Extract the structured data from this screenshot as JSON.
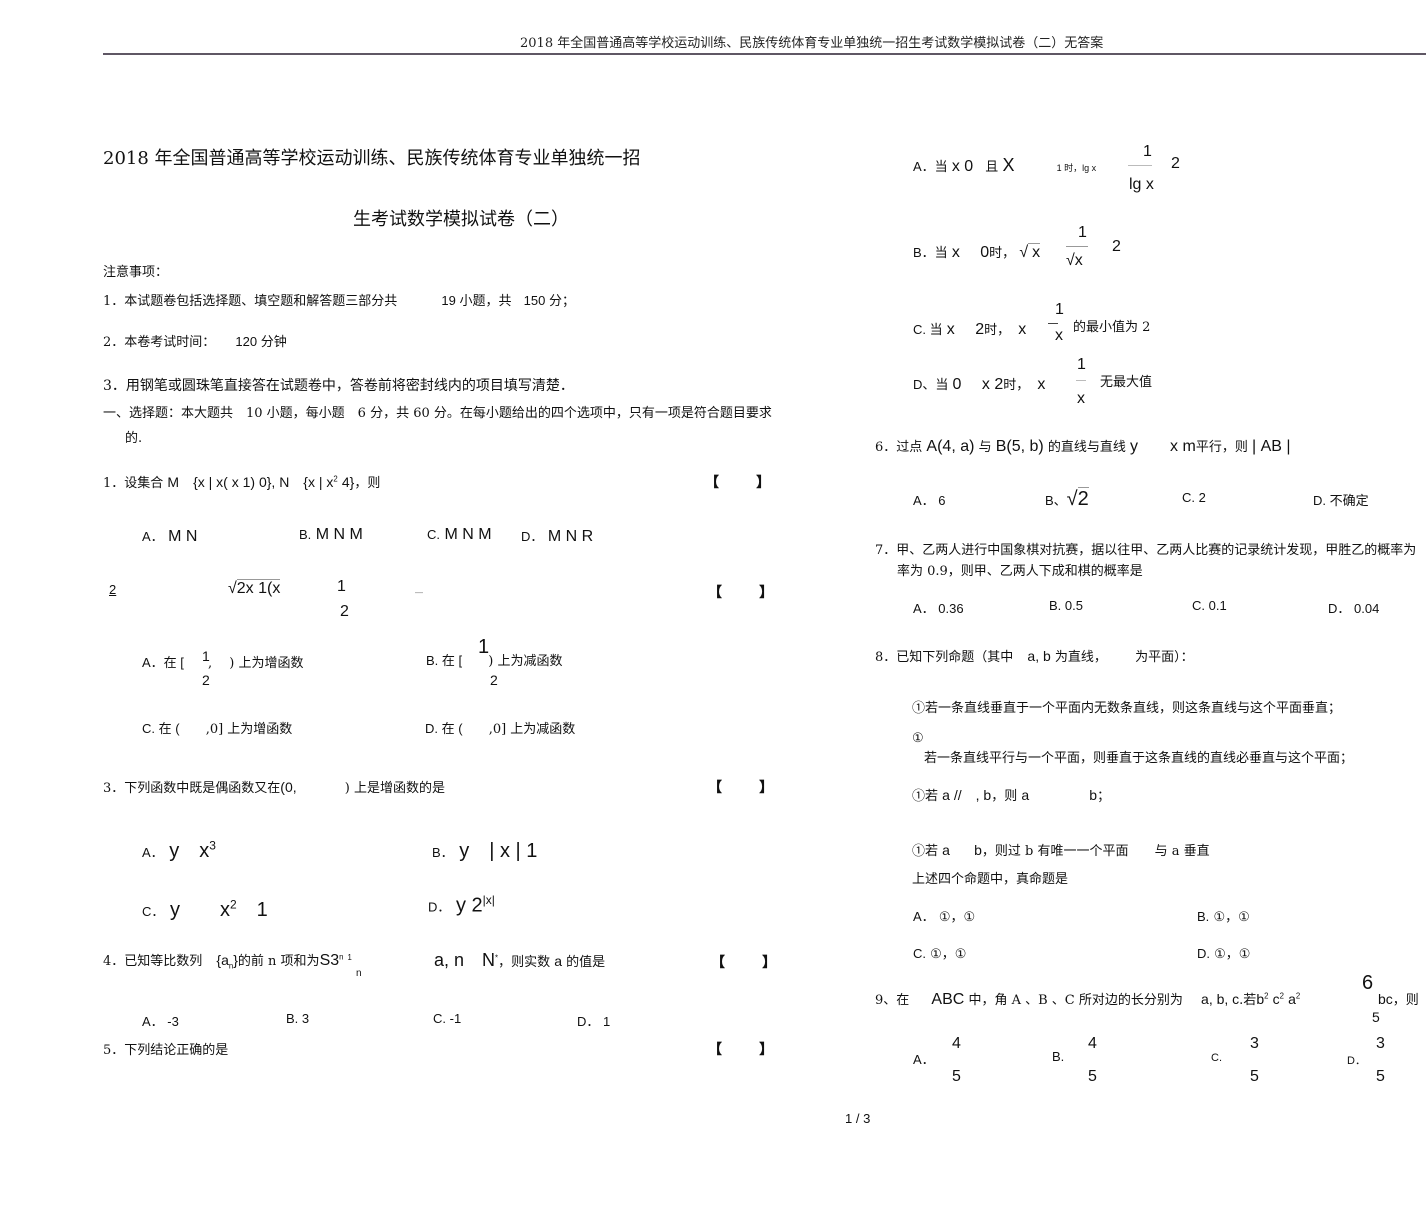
{
  "header": {
    "running_title": "2018 年全国普通高等学校运动训练、民族传统体育专业单独统一招生考试数学模拟试卷（二）无答案"
  },
  "title": {
    "line1": "2018 年全国普通高等学校运动训练、民族传统体育专业单独统一招",
    "line2": "生考试数学模拟试卷（二）"
  },
  "notes": {
    "heading": "注意事项：",
    "items": [
      {
        "prefix": "1．本试题卷包括选择题、填空题和解答题三部分共",
        "mid": "19 小题，共",
        "end": "150 分；"
      },
      {
        "prefix": "2．本卷考试时间：",
        "end": "120 分钟"
      },
      {
        "prefix": "3．用钢笔或圆珠笔直接答在试题卷中，答卷前将密封线内的项目填写清楚．"
      }
    ]
  },
  "section": {
    "line1": "一、选择题：本大题共　10 小题，每小题　6 分，共 60 分。在每小题给出的四个选项中，只有一项是符合题目要求",
    "line2": "的."
  },
  "bracket": {
    "open": "【",
    "close": "】"
  },
  "q1": {
    "stem_prefix": "1．设集合",
    "stem_math": "M　{x | x( x  1)   0}, N　{x | x",
    "exp": "2",
    "stem_math2": "4}",
    "stem_suffix": "，则",
    "options": [
      {
        "label": "A．",
        "text": "M  N"
      },
      {
        "label": "B.",
        "text": "M  N  M"
      },
      {
        "label": "C.",
        "text": "M  N  M"
      },
      {
        "label": "D．",
        "text": "M  N  R"
      }
    ]
  },
  "q2": {
    "num": "2",
    "root": "2x  1(x",
    "frac_num": "1",
    "frac_den": "2",
    "dash": "—",
    "options": [
      {
        "label": "A．在 [",
        "num": "1",
        "den": "2",
        "tail": ",　 ) 上为增函数"
      },
      {
        "label": "B.  在 [",
        "num": "1",
        "den": "2",
        "tail": ") 上为减函数"
      },
      {
        "label": "C.  在 (",
        "tail": ",0] 上为增函数"
      },
      {
        "label": "D.  在 (",
        "tail": ",0] 上为减函数"
      }
    ]
  },
  "q3": {
    "stem_prefix": "3．下列函数中既是偶函数又在",
    "stem_interval": "(0,",
    "stem_suffix": ") 上是增函数的是",
    "options": [
      {
        "label": "A．",
        "math": "y　x",
        "exp": "3"
      },
      {
        "label": "B．",
        "math": "y　| x |  1"
      },
      {
        "label": "C．",
        "math": "y　　x",
        "exp": "2",
        "tail": "　1"
      },
      {
        "label": "D．",
        "math": "y  2",
        "exp": "|x|"
      }
    ]
  },
  "q4": {
    "stem_prefix": "4．已知等比数列",
    "seq": "{a",
    "seq_sub": "n",
    "seq_close": "}",
    "stem_mid": "的前 n 项和为",
    "sum": "S3",
    "sum_exp": "n",
    "sum_exp2": "1",
    "sum_sub": "n",
    "math2": "a, n　N",
    "star": "*",
    "stem_suffix": "，则实数",
    "var": "a",
    "stem_end": "的值是",
    "options": [
      {
        "label": "A．",
        "text": "-3"
      },
      {
        "label": "B.",
        "text": "3"
      },
      {
        "label": "C.",
        "text": "-1"
      },
      {
        "label": "D．",
        "text": "1"
      }
    ]
  },
  "q5": {
    "stem": "5．下列结论正确的是",
    "options": [
      {
        "label": "A．当",
        "math": "x  0",
        "mid": "且",
        "math2": "X",
        "small": "1 时，lg x",
        "num": "1",
        "den": "lg x",
        "tail": "2"
      },
      {
        "label": "B．当",
        "math": "x　 0",
        "mid": "时，",
        "root": "x",
        "num": "1",
        "den": "x",
        "tail": "2"
      },
      {
        "label": "C. 当",
        "math": "x　  2",
        "mid": "时，",
        "math2": "x",
        "num": "1",
        "den": "x",
        "tail": "的最小值为  2"
      },
      {
        "label": "D、当",
        "math": "0　 x   2",
        "mid": "时，",
        "math2": "x",
        "num": "1",
        "den": "x",
        "tail": "无最大值"
      }
    ]
  },
  "q6": {
    "stem_prefix": "6．过点",
    "pa": "A(4, a)",
    "mid1": "与",
    "pb": "B(5, b)",
    "mid2": "的直线与直线",
    "line": "y　　x  m",
    "mid3": "平行，则",
    "abs": "| AB |",
    "options": [
      {
        "label": "A．",
        "text": "6"
      },
      {
        "label": "B、",
        "text": "2"
      },
      {
        "label": "C.",
        "text": "2"
      },
      {
        "label": "D.",
        "text": "不确定"
      }
    ]
  },
  "q7": {
    "line1": "7．甲、乙两人进行中国象棋对抗赛，据以往甲、乙两人比赛的记录统计发现，甲胜乙的概率为",
    "line2": "率为 0.9，则甲、乙两人下成和棋的概率是",
    "options": [
      {
        "label": "A．",
        "text": "0.36"
      },
      {
        "label": "B.",
        "text": "0.5"
      },
      {
        "label": "C.",
        "text": "0.1"
      },
      {
        "label": "D．",
        "text": "0.04"
      }
    ]
  },
  "q8": {
    "stem_prefix": "8．已知下列命题（其中",
    "vars": "a, b",
    "stem_mid": "为直线，",
    "stem_suffix": "为平面）：",
    "props": [
      "①若一条直线垂直于一个平面内无数条直线，则这条直线与这个平面垂直；",
      "①",
      "若一条直线平行与一个平面，则垂直于这条直线的直线必垂直与这个平面；",
      "①若",
      "①若"
    ],
    "prop3_math": "a //　, b",
    "prop3_mid": "，则",
    "prop3_a": "a",
    "prop3_b": "b",
    "prop3_end": "；",
    "prop4_a": "a",
    "prop4_b": "b",
    "prop4_mid": "，则过 b 有唯一一个平面",
    "prop4_end": "与 a 垂直",
    "question": "上述四个命题中，真命题是",
    "options": [
      {
        "label": "A．",
        "text": "①，①"
      },
      {
        "label": "B.",
        "text": "①，①"
      },
      {
        "label": "C.",
        "text": "①，①"
      },
      {
        "label": "D.",
        "text": "①，①"
      }
    ]
  },
  "q9": {
    "stem_prefix": "9、在",
    "tri": "ABC",
    "stem_mid": "中，角  A 、B 、C 所对边的长分别为",
    "sides": "a, b, c",
    "if": ".若",
    "eq": "b",
    "eq_e1": "2",
    "eq2": "c",
    "eq_e2": "2",
    "eq3": "a",
    "eq_e3": "2",
    "frac_num": "6",
    "frac_den": "5",
    "bc": "bc",
    "stem_end": "，则",
    "options": [
      {
        "label": "A．",
        "num": "4",
        "den": "5"
      },
      {
        "label": "B.",
        "num": "4",
        "den": "5"
      },
      {
        "label": "C.",
        "num": "3",
        "den": "5"
      },
      {
        "label": "D．",
        "num": "3",
        "den": "5"
      }
    ]
  },
  "footer": {
    "page": "1 / 3"
  }
}
